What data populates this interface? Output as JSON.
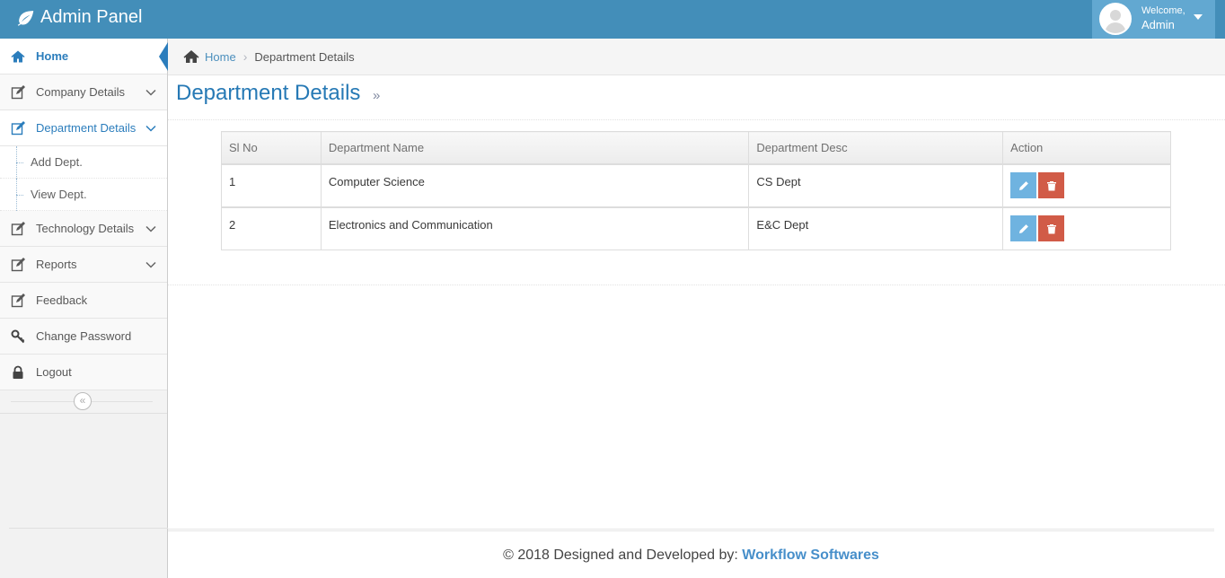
{
  "navbar": {
    "brand": "Admin Panel",
    "welcome": "Welcome,",
    "user": "Admin"
  },
  "sidebar": {
    "items": [
      {
        "label": "Home"
      },
      {
        "label": "Company Details"
      },
      {
        "label": "Department Details"
      },
      {
        "label": "Technology Details"
      },
      {
        "label": "Reports"
      },
      {
        "label": "Feedback"
      },
      {
        "label": "Change Password"
      },
      {
        "label": "Logout"
      }
    ],
    "subitems": [
      {
        "label": "Add Dept."
      },
      {
        "label": "View Dept."
      }
    ],
    "collapse_glyph": "«"
  },
  "breadcrumb": {
    "home": "Home",
    "separator": "›",
    "current": "Department Details"
  },
  "page": {
    "title": "Department Details",
    "title_sep": "»"
  },
  "table": {
    "headers": [
      "Sl No",
      "Department Name",
      "Department Desc",
      "Action"
    ],
    "rows": [
      {
        "sl": "1",
        "name": "Computer Science",
        "desc": "CS Dept"
      },
      {
        "sl": "2",
        "name": "Electronics and Communication",
        "desc": "E&C Dept"
      }
    ]
  },
  "footer": {
    "text": "© 2018 Designed and Developed by:",
    "company": "Workflow Softwares"
  },
  "colors": {
    "navbar": "#438eb9",
    "accent": "#2b7dbc",
    "edit_button": "#6fb3e0",
    "delete_button": "#d15b47"
  },
  "icons": {
    "brand": "leaf-icon",
    "home": "home-icon",
    "edit": "pencil-square-icon",
    "key": "key-icon",
    "lock": "lock-icon",
    "chevron": "chevron-down-icon",
    "pencil": "pencil-icon",
    "trash": "trash-icon"
  }
}
